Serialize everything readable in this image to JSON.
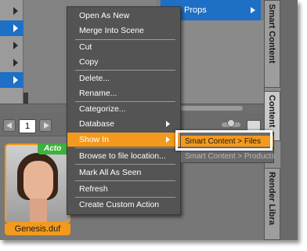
{
  "top_panel": {
    "props_label": "Props"
  },
  "pager": {
    "page_number": "1"
  },
  "content": {
    "thumbnail_badge": "Acto",
    "thumbnail_caption": "Genesis.duf"
  },
  "right_tabs": {
    "smart_content": "Smart Content",
    "content_library": "Content",
    "render_library": "Render Libra"
  },
  "context_menu": {
    "items": [
      {
        "label": "Open As New"
      },
      {
        "label": "Merge Into Scene"
      },
      {
        "label": "Cut"
      },
      {
        "label": "Copy"
      },
      {
        "label": "Delete..."
      },
      {
        "label": "Rename..."
      },
      {
        "label": "Categorize..."
      },
      {
        "label": "Database",
        "has_submenu": true
      },
      {
        "label": "Show In",
        "has_submenu": true,
        "highlighted": true
      },
      {
        "label": "Browse to file location..."
      },
      {
        "label": "Mark All As Seen"
      },
      {
        "label": "Refresh"
      },
      {
        "label": "Create Custom Action"
      }
    ]
  },
  "submenu": {
    "items": [
      {
        "label": "Smart Content > Files",
        "highlighted": true
      },
      {
        "label": "Smart Content > Products"
      }
    ]
  },
  "colors": {
    "highlight": "#f39a1e",
    "selection_blue": "#1e6fc6",
    "menu_bg": "#545454",
    "badge_green": "#3fb13f"
  }
}
